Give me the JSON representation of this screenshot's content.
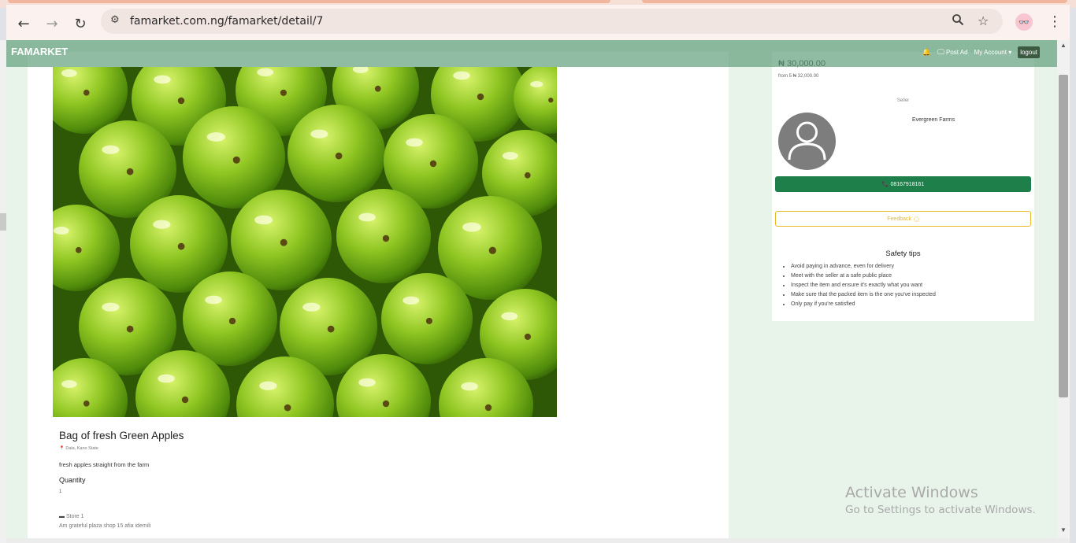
{
  "browser": {
    "url": "famarket.com.ng/famarket/detail/7",
    "back_icon": "back-arrow-icon",
    "forward_icon": "forward-arrow-icon",
    "reload_icon": "reload-icon",
    "site_info_icon": "site-info-icon",
    "zoom_icon": "zoom-icon",
    "bookmark_icon": "star-icon",
    "menu_icon": "kebab-menu-icon"
  },
  "navbar": {
    "brand": "FAMARKET",
    "post_ad": "Post Ad",
    "my_account": "My Account",
    "logout": "logout"
  },
  "product": {
    "title": "Bag of fresh Green Apples",
    "location": "Dala, Kano State",
    "description": "fresh apples straight from the farm",
    "quantity_label": "Quantity",
    "quantity_value": "1",
    "store": "Store 1",
    "store_address": "Am grateful plaza shop 15 afia idemili"
  },
  "sidebar": {
    "price": "₦ 30,000.00",
    "price_from": "from 5 ₦ 32,000.00",
    "seller_label": "Seller",
    "seller_name": "Evergreen Farms",
    "phone": "08167918161",
    "feedback": "Feedback",
    "safety_title": "Safety tips",
    "safety_tips": [
      "Avoid paying in advance, even for delivery",
      "Meet with the seller at a safe public place",
      "Inspect the item and ensure it's exactly what you want",
      "Make sure that the packed item is the one you've inspected",
      "Only pay if you're satisfied"
    ]
  },
  "watermark": {
    "line1": "Activate Windows",
    "line2": "Go to Settings to activate Windows."
  },
  "colors": {
    "navbar": "#5c9c78",
    "call_button": "#1e7f4a",
    "feedback_border": "#e9b826",
    "page_bg": "#e8f3ea"
  }
}
